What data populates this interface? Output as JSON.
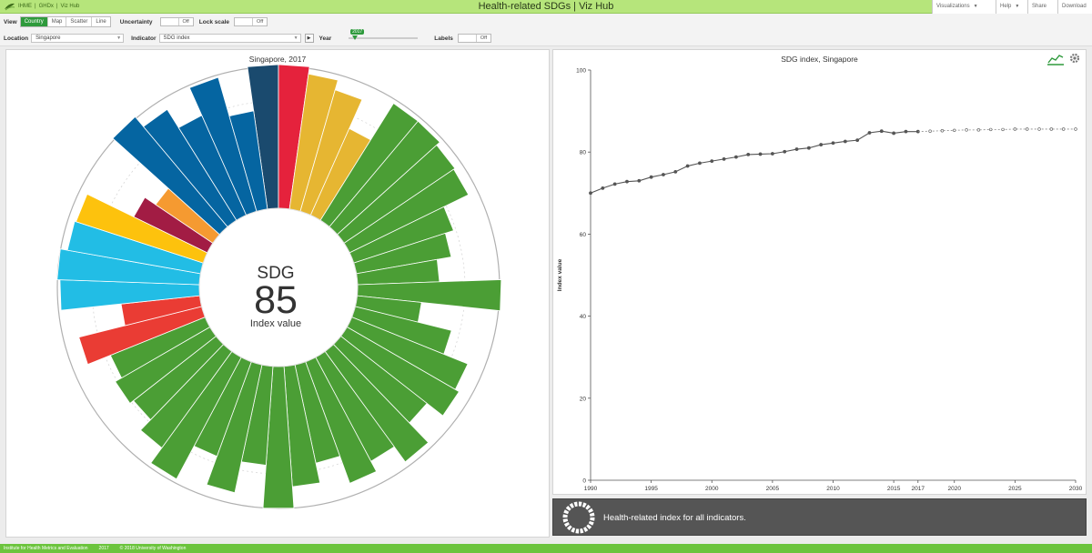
{
  "header": {
    "brand": [
      "IHME",
      "GHDx",
      "Viz Hub"
    ],
    "title": "Health-related SDGs | Viz Hub",
    "menu": [
      {
        "label": "Visualizations",
        "has_caret": true
      },
      {
        "label": "Help",
        "has_caret": true
      },
      {
        "label": "Share",
        "has_caret": false
      },
      {
        "label": "Download",
        "has_caret": false
      }
    ]
  },
  "toolbar": {
    "view_label": "View",
    "views": [
      "Country",
      "Map",
      "Scatter",
      "Line"
    ],
    "active_view": "Country",
    "uncertainty_label": "Uncertainty",
    "uncertainty_state": "Off",
    "lock_scale_label": "Lock scale",
    "lock_scale_state": "Off",
    "location_label": "Location",
    "location_value": "Singapore",
    "indicator_label": "Indicator",
    "indicator_value": "SDG index",
    "year_label": "Year",
    "year_value": "2017",
    "year_fraction": 0.05,
    "labels_label": "Labels",
    "labels_state": "Off"
  },
  "left_panel": {
    "title": "Singapore, 2017",
    "center_line1": "SDG",
    "center_value": "85",
    "center_line3": "Index value"
  },
  "right_panel": {
    "title": "SDG index, Singapore"
  },
  "info_bar": {
    "text": "Health-related index for all indicators."
  },
  "footer": {
    "items": [
      "Institute for Health Metrics and Evaluation",
      "2017",
      "© 2018 University of Washington"
    ]
  },
  "colors": {
    "navy": "#1a4a6e",
    "red": "#e5223c",
    "yellow": "#e6b632",
    "green": "#4b9e35",
    "blue": "#0565a1",
    "orange": "#f59a31",
    "crimson": "#a21c44",
    "gold": "#fdc20d",
    "cyan": "#22bde5",
    "coral": "#ea3c34",
    "header_green": "#b6e57b",
    "footer_green": "#6cc43d",
    "toggle_green": "#2e9a3c"
  },
  "radial": [
    {
      "color": "navy",
      "value": 1.0
    },
    {
      "color": "red",
      "value": 1.0
    },
    {
      "color": "yellow",
      "value": 0.95
    },
    {
      "color": "yellow",
      "value": 0.88
    },
    {
      "color": "yellow",
      "value": 0.66
    },
    {
      "color": "green",
      "value": 0.96
    },
    {
      "color": "green",
      "value": 0.96
    },
    {
      "color": "green",
      "value": 0.93
    },
    {
      "color": "green",
      "value": 0.92
    },
    {
      "color": "green",
      "value": 0.73
    },
    {
      "color": "green",
      "value": 0.67
    },
    {
      "color": "green",
      "value": 0.57
    },
    {
      "color": "green",
      "value": 1.0
    },
    {
      "color": "green",
      "value": 0.45
    },
    {
      "color": "green",
      "value": 0.69
    },
    {
      "color": "green",
      "value": 0.87
    },
    {
      "color": "green",
      "value": 0.9
    },
    {
      "color": "green",
      "value": 0.76
    },
    {
      "color": "green",
      "value": 0.95
    },
    {
      "color": "green",
      "value": 0.82
    },
    {
      "color": "green",
      "value": 0.9
    },
    {
      "color": "green",
      "value": 0.7
    },
    {
      "color": "green",
      "value": 0.84
    },
    {
      "color": "green",
      "value": 0.99
    },
    {
      "color": "green",
      "value": 0.69
    },
    {
      "color": "green",
      "value": 0.91
    },
    {
      "color": "green",
      "value": 0.7
    },
    {
      "color": "green",
      "value": 0.96
    },
    {
      "color": "green",
      "value": 0.83
    },
    {
      "color": "green",
      "value": 0.73
    },
    {
      "color": "green",
      "value": 0.76
    },
    {
      "color": "green",
      "value": 0.71
    },
    {
      "color": "coral",
      "value": 0.88
    },
    {
      "color": "coral",
      "value": 0.55
    },
    {
      "color": "cyan",
      "value": 0.97
    },
    {
      "color": "cyan",
      "value": 0.99
    },
    {
      "color": "cyan",
      "value": 0.94
    },
    {
      "color": "gold",
      "value": 0.93
    },
    {
      "color": "crimson",
      "value": 0.57
    },
    {
      "color": "orange",
      "value": 0.48
    },
    {
      "color": "blue",
      "value": 1.0
    },
    {
      "color": "blue",
      "value": 0.91
    },
    {
      "color": "blue",
      "value": 0.76
    },
    {
      "color": "blue",
      "value": 0.97
    },
    {
      "color": "blue",
      "value": 0.69
    }
  ],
  "chart_data": {
    "type": "line",
    "title": "SDG index, Singapore",
    "xlabel": "",
    "ylabel": "Index value",
    "xlim": [
      1990,
      2030
    ],
    "ylim": [
      0,
      100
    ],
    "x_ticks": [
      1990,
      1995,
      2000,
      2005,
      2010,
      2015,
      2017,
      2020,
      2025,
      2030
    ],
    "y_ticks": [
      0,
      20,
      40,
      60,
      80,
      100
    ],
    "series": [
      {
        "x": [
          1990,
          1991,
          1992,
          1993,
          1994,
          1995,
          1996,
          1997,
          1998,
          1999,
          2000,
          2001,
          2002,
          2003,
          2004,
          2005,
          2006,
          2007,
          2008,
          2009,
          2010,
          2011,
          2012,
          2013,
          2014,
          2015,
          2016,
          2017
        ],
        "y": [
          70.0,
          71.2,
          72.2,
          72.8,
          73.0,
          73.9,
          74.5,
          75.2,
          76.6,
          77.3,
          77.8,
          78.3,
          78.8,
          79.4,
          79.5,
          79.6,
          80.1,
          80.7,
          81.0,
          81.8,
          82.2,
          82.6,
          82.9,
          84.7,
          85.1,
          84.6,
          85.0,
          85.0
        ],
        "style": "solid"
      },
      {
        "x": [
          2017,
          2018,
          2019,
          2020,
          2021,
          2022,
          2023,
          2024,
          2025,
          2026,
          2027,
          2028,
          2029,
          2030
        ],
        "y": [
          85.0,
          85.1,
          85.2,
          85.3,
          85.4,
          85.4,
          85.5,
          85.5,
          85.6,
          85.6,
          85.6,
          85.6,
          85.6,
          85.6
        ],
        "style": "dashed"
      }
    ]
  }
}
